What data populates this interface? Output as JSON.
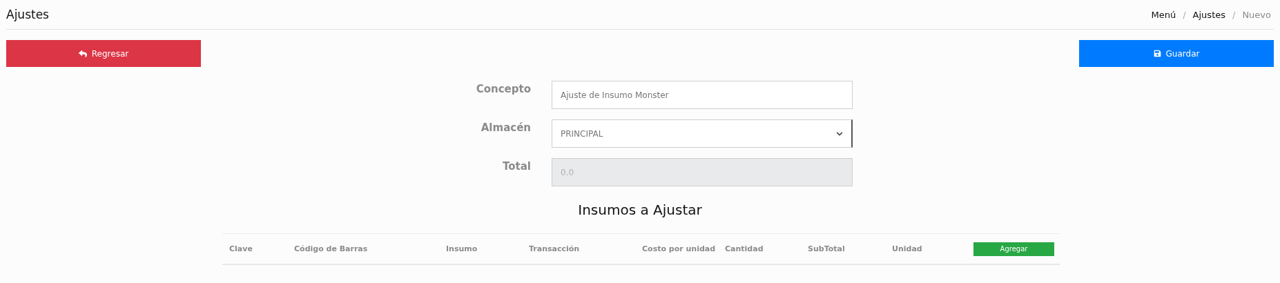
{
  "page_title": "Ajustes",
  "breadcrumb": [
    {
      "label": "Menú",
      "current": false
    },
    {
      "label": "Ajustes",
      "current": false
    },
    {
      "label": "Nuevo",
      "current": true
    }
  ],
  "breadcrumb_separator": "/",
  "back_button": {
    "label": "Regresar"
  },
  "save_button": {
    "label": "Guardar"
  },
  "form": [
    {
      "kind": "text",
      "label": "Concepto",
      "value": "Ajuste de Insumo Monster",
      "disabled": false
    },
    {
      "kind": "select",
      "label": "Almacén",
      "value": "PRINCIPAL",
      "disabled": false
    },
    {
      "kind": "text",
      "label": "Total",
      "value": "0.0",
      "disabled": true
    }
  ],
  "section_title": "Insumos a Ajustar",
  "table": {
    "columns": [
      "Clave",
      "Código de Barras",
      "Insumo",
      "Transacción",
      "Costo por unidad",
      "Cantidad",
      "SubTotal",
      "Unidad"
    ],
    "add_button": "Agregar"
  }
}
